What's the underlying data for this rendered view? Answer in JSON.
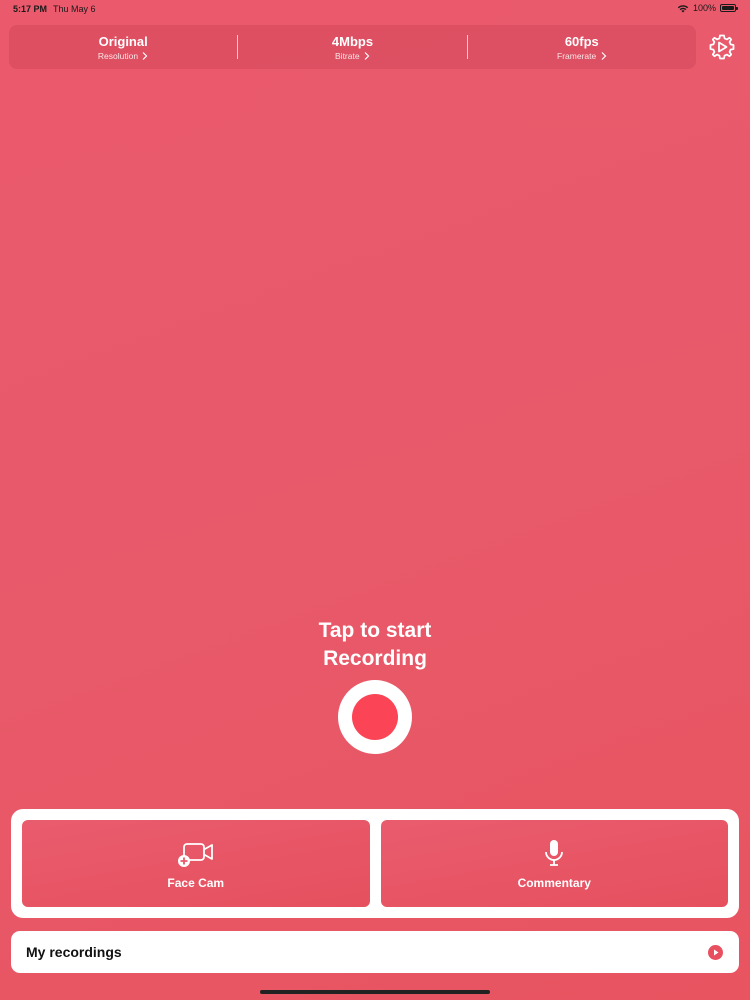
{
  "status_bar": {
    "time": "5:17 PM",
    "date": "Thu May 6",
    "battery": "100%"
  },
  "settings": [
    {
      "value": "Original",
      "label": "Resolution"
    },
    {
      "value": "4Mbps",
      "label": "Bitrate"
    },
    {
      "value": "60fps",
      "label": "Framerate"
    }
  ],
  "record": {
    "line1": "Tap to start",
    "line2": "Recording"
  },
  "modes": {
    "face_cam": "Face Cam",
    "commentary": "Commentary"
  },
  "recordings": {
    "label": "My recordings"
  },
  "colors": {
    "background": "#e85a6b",
    "record_dot": "#fb4455",
    "tile": "#e95c6e"
  },
  "icons": [
    "wifi-icon",
    "battery-icon",
    "gear-icon",
    "chevron-right-icon",
    "face-cam-add-icon",
    "microphone-icon",
    "play-circle-icon"
  ]
}
